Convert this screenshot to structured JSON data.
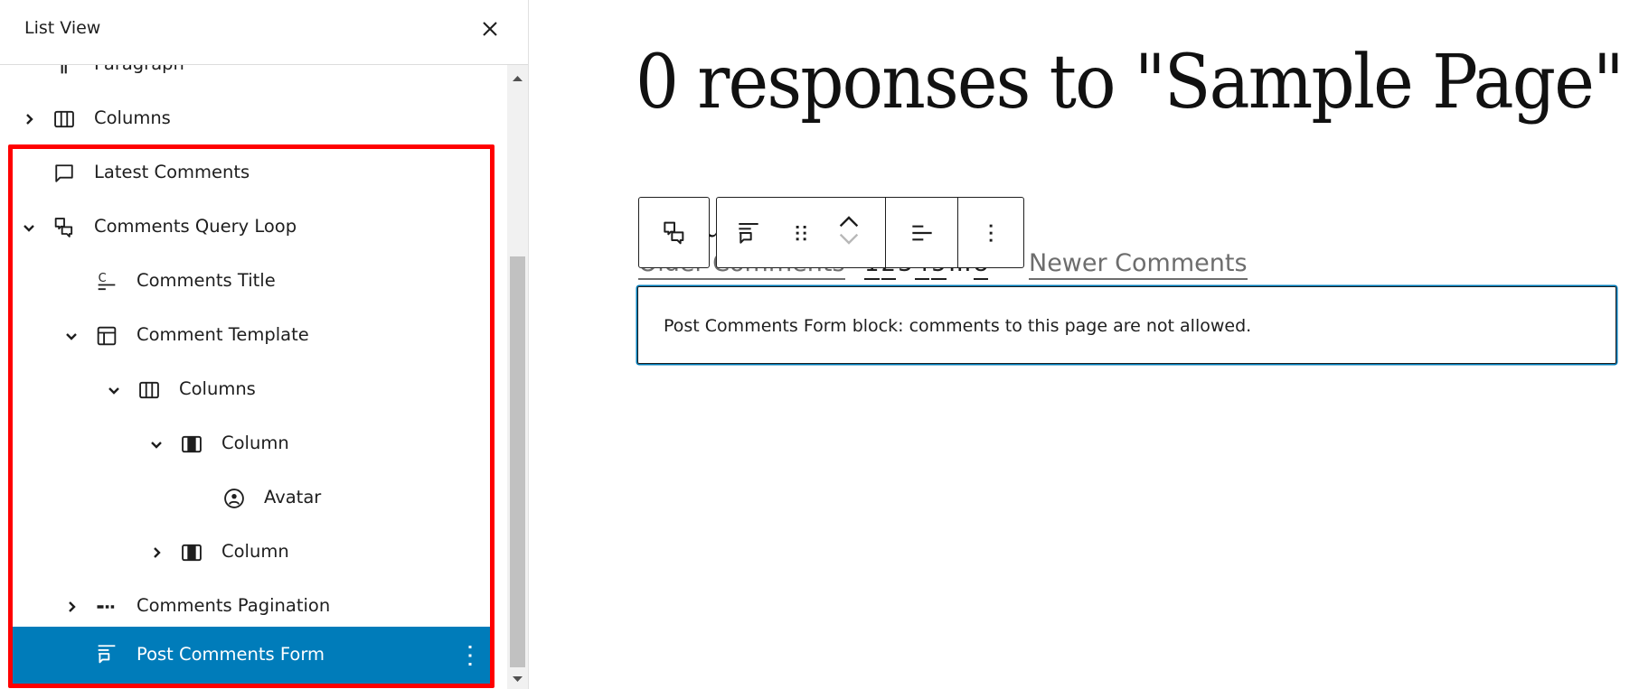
{
  "sidebar": {
    "title": "List View",
    "close_icon": "close-icon",
    "items": [
      {
        "label": "Paragraph",
        "icon": "paragraph-icon",
        "level": 0,
        "expander": "none"
      },
      {
        "label": "Columns",
        "icon": "columns-icon",
        "level": 0,
        "expander": "collapsed"
      },
      {
        "label": "Latest Comments",
        "icon": "comment-icon",
        "level": 0,
        "expander": "none"
      },
      {
        "label": "Comments Query Loop",
        "icon": "comments-query-loop-icon",
        "level": 0,
        "expander": "expanded"
      },
      {
        "label": "Comments Title",
        "icon": "comments-title-icon",
        "level": 1,
        "expander": "none"
      },
      {
        "label": "Comment Template",
        "icon": "layout-icon",
        "level": 1,
        "expander": "expanded"
      },
      {
        "label": "Columns",
        "icon": "columns-icon",
        "level": 2,
        "expander": "expanded"
      },
      {
        "label": "Column",
        "icon": "column-icon",
        "level": 3,
        "expander": "expanded"
      },
      {
        "label": "Avatar",
        "icon": "avatar-icon",
        "level": 4,
        "expander": "none"
      },
      {
        "label": "Column",
        "icon": "column-icon",
        "level": 3,
        "expander": "collapsed"
      },
      {
        "label": "Comments Pagination",
        "icon": "pagination-icon",
        "level": 1,
        "expander": "collapsed"
      },
      {
        "label": "Post Comments Form",
        "icon": "post-comments-form-icon",
        "level": 1,
        "expander": "none",
        "selected": true
      }
    ]
  },
  "canvas": {
    "heading": "0 responses to \"Sample Page\"",
    "comments_title_partial": "su",
    "pagination": {
      "older": "Older Comments",
      "numbers": [
        "1",
        "2",
        "3",
        "4",
        "5",
        "…",
        "8"
      ],
      "newer": "Newer Comments"
    },
    "form_notice": "Post Comments Form block: comments to this page are not allowed."
  },
  "toolbar": {
    "parent_block": "select-parent-comments-query-loop",
    "buttons": [
      "block-type-post-comments-form",
      "drag-handle",
      "move-up",
      "move-down",
      "align",
      "more-options"
    ]
  },
  "colors": {
    "accent": "#007cba",
    "highlight_border": "#ff0000",
    "text": "#1e1e1e"
  }
}
